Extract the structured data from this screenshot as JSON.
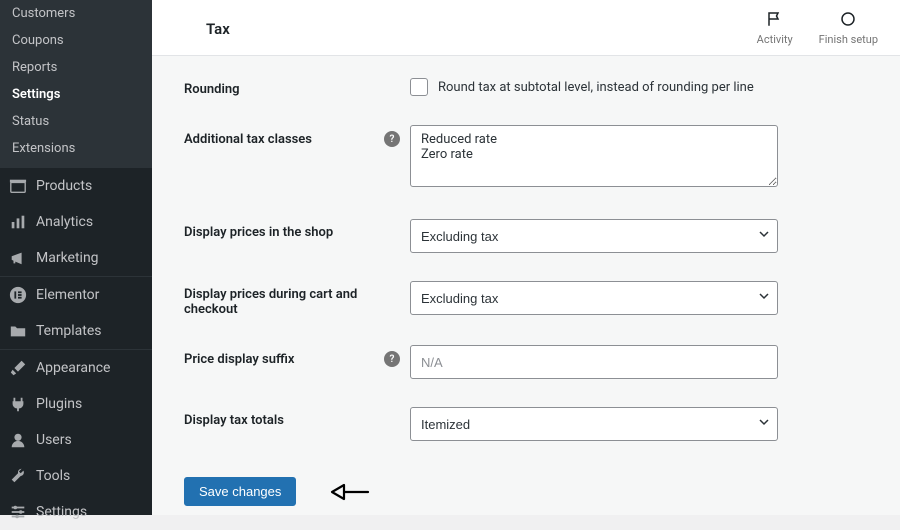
{
  "sidebar": {
    "sub_items": [
      {
        "label": "Customers",
        "selected": false
      },
      {
        "label": "Coupons",
        "selected": false
      },
      {
        "label": "Reports",
        "selected": false
      },
      {
        "label": "Settings",
        "selected": true
      },
      {
        "label": "Status",
        "selected": false
      },
      {
        "label": "Extensions",
        "selected": false
      }
    ],
    "menu": [
      {
        "label": "Products",
        "icon": "archive-icon"
      },
      {
        "label": "Analytics",
        "icon": "bars-icon"
      },
      {
        "label": "Marketing",
        "icon": "megaphone-icon"
      }
    ],
    "menu2": [
      {
        "label": "Elementor",
        "icon": "elementor-icon"
      },
      {
        "label": "Templates",
        "icon": "folder-icon"
      }
    ],
    "menu3": [
      {
        "label": "Appearance",
        "icon": "brush-icon"
      },
      {
        "label": "Plugins",
        "icon": "plug-icon"
      },
      {
        "label": "Users",
        "icon": "user-icon"
      },
      {
        "label": "Tools",
        "icon": "wrench-icon"
      },
      {
        "label": "Settings",
        "icon": "sliders-icon"
      }
    ]
  },
  "header": {
    "title": "Tax",
    "activity_label": "Activity",
    "finish_label": "Finish setup"
  },
  "form": {
    "rounding": {
      "label": "Rounding",
      "checkbox_text": "Round tax at subtotal level, instead of rounding per line",
      "checked": false
    },
    "additional_tax_classes": {
      "label": "Additional tax classes",
      "value": "Reduced rate\nZero rate"
    },
    "display_prices_shop": {
      "label": "Display prices in the shop",
      "value": "Excluding tax"
    },
    "display_prices_cart": {
      "label": "Display prices during cart and checkout",
      "value": "Excluding tax"
    },
    "price_display_suffix": {
      "label": "Price display suffix",
      "placeholder": "N/A",
      "value": ""
    },
    "display_tax_totals": {
      "label": "Display tax totals",
      "value": "Itemized"
    },
    "save_button": "Save changes"
  }
}
